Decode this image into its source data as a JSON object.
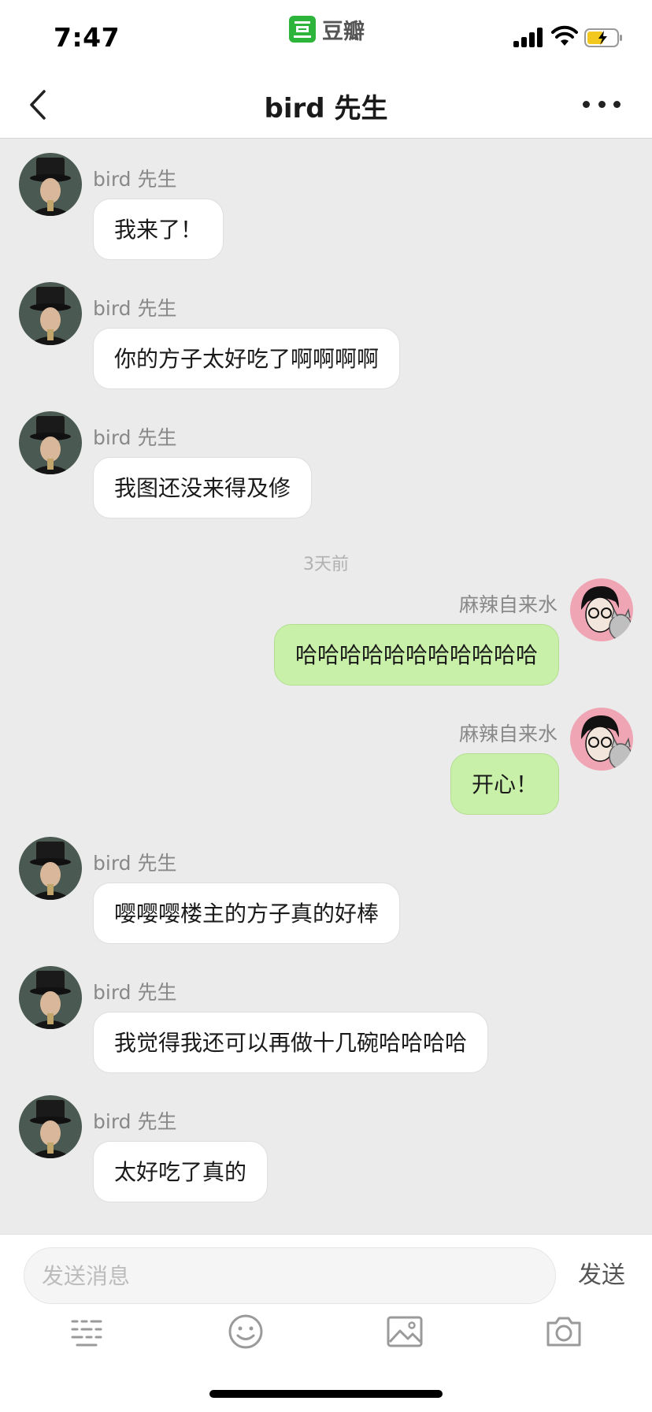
{
  "status_bar": {
    "time": "7:47",
    "app_name": "豆瓣"
  },
  "header": {
    "title": "bird 先生"
  },
  "messages": [
    {
      "sender": "bird 先生",
      "side": "left",
      "text": "我来了！"
    },
    {
      "sender": "bird 先生",
      "side": "left",
      "text": "你的方子太好吃了啊啊啊啊"
    },
    {
      "sender": "bird 先生",
      "side": "left",
      "text": "我图还没来得及修"
    },
    {
      "sender": "麻辣自来水",
      "side": "right",
      "text": "哈哈哈哈哈哈哈哈哈哈哈"
    },
    {
      "sender": "麻辣自来水",
      "side": "right",
      "text": "开心！"
    },
    {
      "sender": "bird 先生",
      "side": "left",
      "text": "嘤嘤嘤楼主的方子真的好棒"
    },
    {
      "sender": "bird 先生",
      "side": "left",
      "text": "我觉得我还可以再做十几碗哈哈哈哈"
    },
    {
      "sender": "bird 先生",
      "side": "left",
      "text": "太好吃了真的"
    }
  ],
  "timestamp": "3天前",
  "input": {
    "placeholder": "发送消息",
    "value": "",
    "send_label": "发送"
  },
  "toolbar": {
    "icons": [
      "keyboard-icon",
      "emoji-icon",
      "image-icon",
      "camera-icon"
    ]
  },
  "colors": {
    "accent": "#2db43b",
    "own_bubble": "#c9f0a8",
    "background": "#ebebeb"
  }
}
